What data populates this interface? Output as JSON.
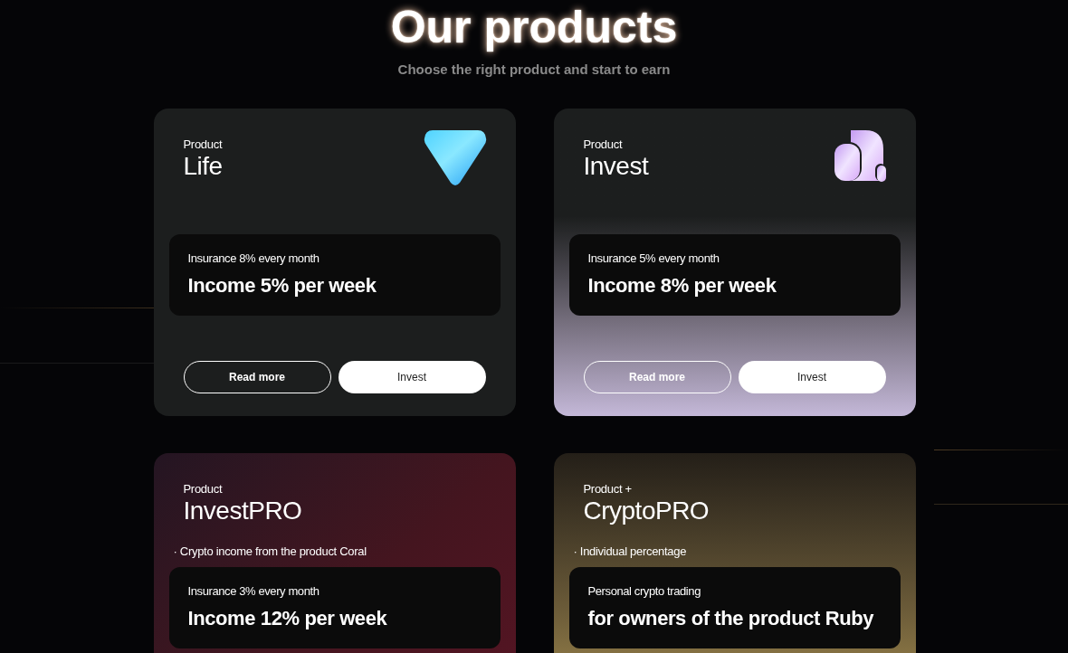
{
  "header": {
    "title": "Our products",
    "subtitle": "Choose the right product and start to earn"
  },
  "products": [
    {
      "kind": "life",
      "label": "Product",
      "name": "Life",
      "insurance": "Insurance 8% every month",
      "income": "Income 5% per week",
      "buttons": [
        "Read more",
        "Invest"
      ]
    },
    {
      "kind": "invest",
      "label": "Product",
      "name": "Invest",
      "insurance": "Insurance 5% every month",
      "income": "Income 8% per week",
      "buttons": [
        "Read more",
        "Invest"
      ]
    },
    {
      "kind": "investpro",
      "label": "Product",
      "name": "InvestPRO",
      "note": "· Crypto income from the product Coral",
      "insurance": "Insurance 3% every month",
      "income": "Income 12% per week"
    },
    {
      "kind": "cryptopro",
      "label": "Product +",
      "name": "CryptoPRO",
      "note": "· Individual percentage",
      "insurance": "Personal crypto trading",
      "income": "for owners of the product Ruby"
    }
  ]
}
